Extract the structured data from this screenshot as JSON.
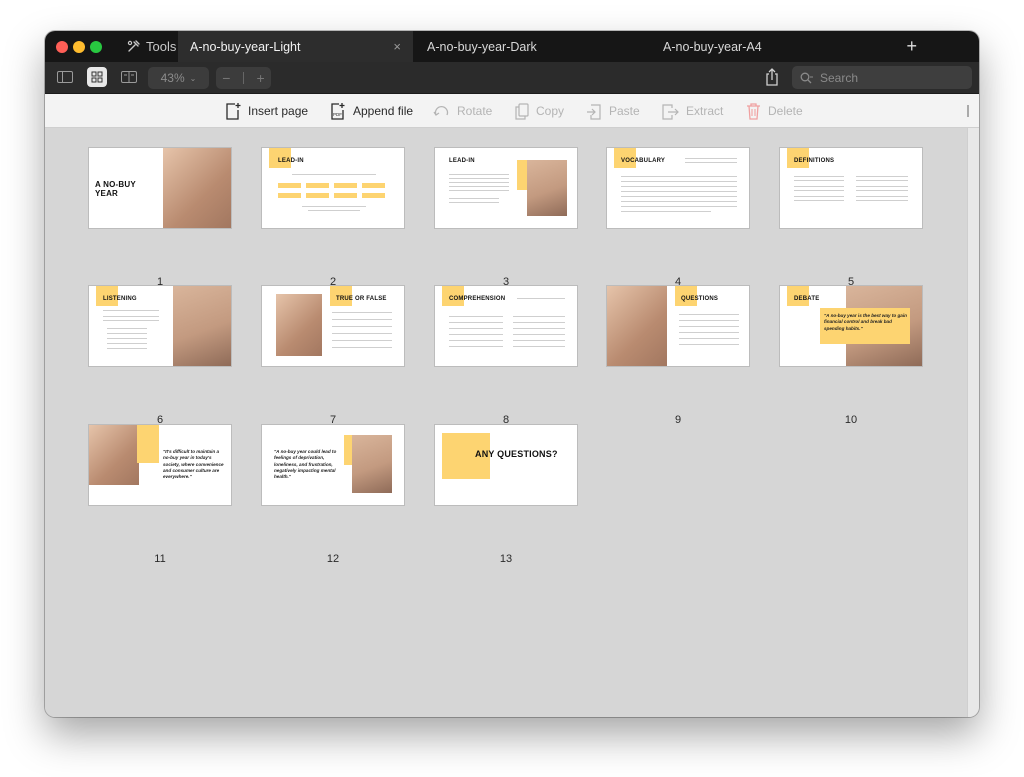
{
  "tabbar": {
    "tools_label": "Tools",
    "tabs": [
      {
        "label": "A-no-buy-year-Light",
        "active": true
      },
      {
        "label": "A-no-buy-year-Dark",
        "active": false
      },
      {
        "label": "A-no-buy-year-A4",
        "active": false
      }
    ],
    "new_tab": "+",
    "close": "×"
  },
  "toolbar": {
    "zoom": "43%",
    "zoom_out": "−",
    "zoom_in": "+",
    "search_placeholder": "Search"
  },
  "actions": [
    {
      "label": "Insert page",
      "icon": "insert-page-icon",
      "enabled": true
    },
    {
      "label": "Append file",
      "icon": "append-file-icon",
      "enabled": true
    },
    {
      "label": "Rotate",
      "icon": "rotate-icon",
      "enabled": false
    },
    {
      "label": "Copy",
      "icon": "copy-icon",
      "enabled": false
    },
    {
      "label": "Paste",
      "icon": "paste-icon",
      "enabled": false
    },
    {
      "label": "Extract",
      "icon": "extract-icon",
      "enabled": false
    },
    {
      "label": "Delete",
      "icon": "trash-icon",
      "enabled": false
    }
  ],
  "pages": [
    {
      "number": "1",
      "title": "A NO-BUY YEAR"
    },
    {
      "number": "2",
      "title": "LEAD-IN"
    },
    {
      "number": "3",
      "title": "LEAD-IN"
    },
    {
      "number": "4",
      "title": "VOCABULARY"
    },
    {
      "number": "5",
      "title": "DEFINITIONS"
    },
    {
      "number": "6",
      "title": "LISTENING"
    },
    {
      "number": "7",
      "title": "TRUE OR FALSE"
    },
    {
      "number": "8",
      "title": "COMPREHENSION"
    },
    {
      "number": "9",
      "title": "QUESTIONS"
    },
    {
      "number": "10",
      "title": "DEBATE",
      "quote": "\"A no-buy year is the best way to gain financial control and break bad spending habits.\""
    },
    {
      "number": "11",
      "quote": "\"It's difficult to maintain a no-buy year in today's society, where convenience and consumer culture are everywhere.\""
    },
    {
      "number": "12",
      "quote": "\"A no-buy year could lead to feelings of deprivation, loneliness, and frustration, negatively impacting mental health.\""
    },
    {
      "number": "13",
      "title": "ANY QUESTIONS?"
    }
  ],
  "colors": {
    "accent_yellow": "#fdd471",
    "close_red": "#ff5f57",
    "minimize_yellow": "#febc2e",
    "zoom_green": "#28c840"
  }
}
